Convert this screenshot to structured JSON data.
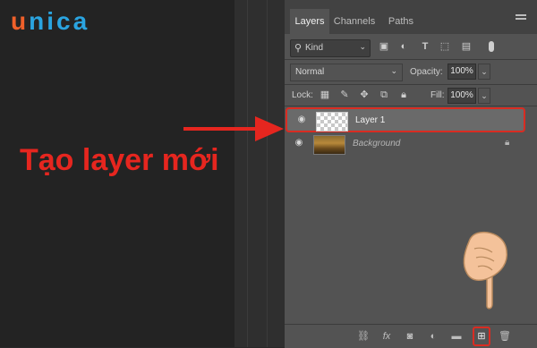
{
  "logo": {
    "u": "u",
    "rest": "nica"
  },
  "caption": "Tạo layer mới",
  "panel": {
    "tabs": [
      {
        "label": "Layers",
        "active": true
      },
      {
        "label": "Channels",
        "active": false
      },
      {
        "label": "Paths",
        "active": false
      }
    ],
    "filter": {
      "kind_label": "Kind",
      "icons": [
        "image-filter-icon",
        "adjustment-filter-icon",
        "type-filter-icon",
        "shape-filter-icon",
        "smart-object-filter-icon",
        "filter-toggle"
      ]
    },
    "blend_mode": "Normal",
    "opacity_label": "Opacity:",
    "opacity_value": "100%",
    "lock_label": "Lock:",
    "fill_label": "Fill:",
    "fill_value": "100%",
    "layers": [
      {
        "name": "Layer 1",
        "selected": true,
        "visible": true
      },
      {
        "name": "Background",
        "selected": false,
        "visible": true,
        "locked": true
      }
    ],
    "bottom_icons": [
      "link-icon",
      "fx-icon",
      "mask-icon",
      "adjustment-icon",
      "folder-icon",
      "new-layer-icon",
      "trash-icon"
    ]
  },
  "colors": {
    "accent_red": "#e6261f",
    "logo_blue": "#2aa4e0",
    "logo_orange": "#f0602a"
  }
}
